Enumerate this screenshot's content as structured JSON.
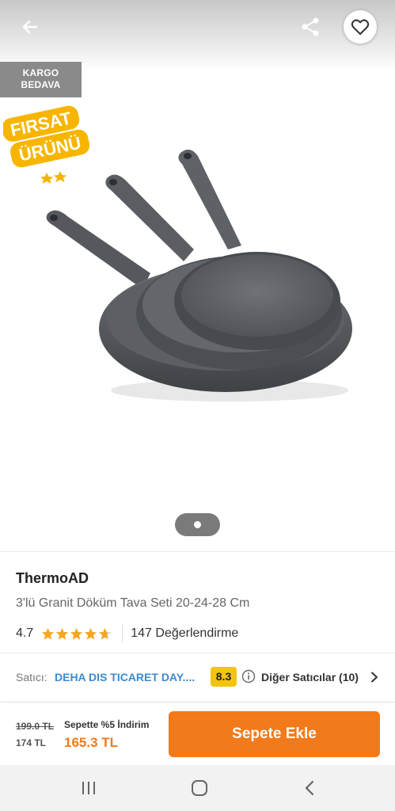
{
  "badges": {
    "cargo_line1": "KARGO",
    "cargo_line2": "BEDAVA",
    "firsat_line1": "FIRSAT",
    "firsat_line2": "ÜRÜNÜ"
  },
  "icons": {
    "back": "arrow-left-icon",
    "share": "share-icon",
    "favorite": "heart-outline-icon",
    "info": "info-circle-icon",
    "chevron": "chevron-right-icon"
  },
  "gallery": {
    "image_count": 1,
    "current_index": 1
  },
  "product": {
    "brand": "ThermoAD",
    "name": "3'lü Granit Döküm Tava Seti 20-24-28 Cm",
    "rating": "4.7",
    "rating_value": 4.7,
    "review_count": "147 Değerlendirme"
  },
  "seller": {
    "label": "Satıcı:",
    "name": "DEHA DIS TICARET DAY....",
    "score": "8.3",
    "other_sellers": "Diğer Satıcılar (10)"
  },
  "price": {
    "old_price": "199.0 TL",
    "base_price": "174 TL",
    "discount_label": "Sepette %5 İndirim",
    "discount_price": "165.3 TL",
    "add_to_cart": "Sepete Ekle"
  },
  "colors": {
    "accent": "#f27a1a",
    "seller_link": "#3b8bd0",
    "score_badge": "#f2c40f",
    "star": "#f5a623",
    "cargo_badge": "#8a8a8a"
  }
}
